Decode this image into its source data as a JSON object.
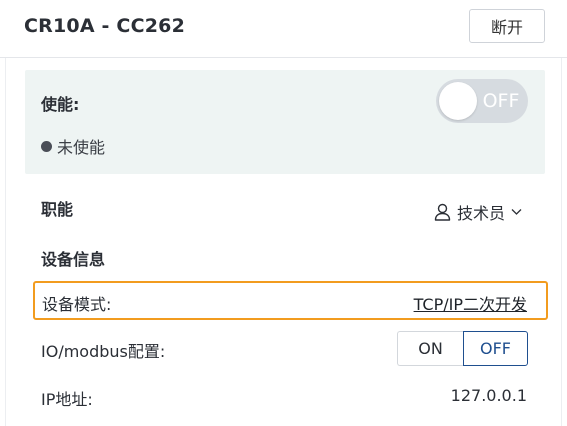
{
  "header": {
    "title": "CR10A - CC262",
    "disconnect_label": "断开"
  },
  "enable": {
    "label": "使能:",
    "toggle_text": "OFF",
    "toggle_state": "off",
    "status_text": "未使能"
  },
  "role": {
    "label": "职能",
    "selected": "技术员"
  },
  "device_info": {
    "heading": "设备信息",
    "mode_label": "设备模式:",
    "mode_value": "TCP/IP二次开发",
    "io_label": "IO/modbus配置:",
    "io_options": [
      "ON",
      "OFF"
    ],
    "io_selected": "OFF",
    "ip_label": "IP地址:",
    "ip_value": "127.0.0.1"
  },
  "colors": {
    "highlight_border": "#f29c1f",
    "enable_card_bg": "#eef4f3",
    "toggle_bg": "#d6dbe0",
    "selected_segment": "#1f4f8f"
  }
}
